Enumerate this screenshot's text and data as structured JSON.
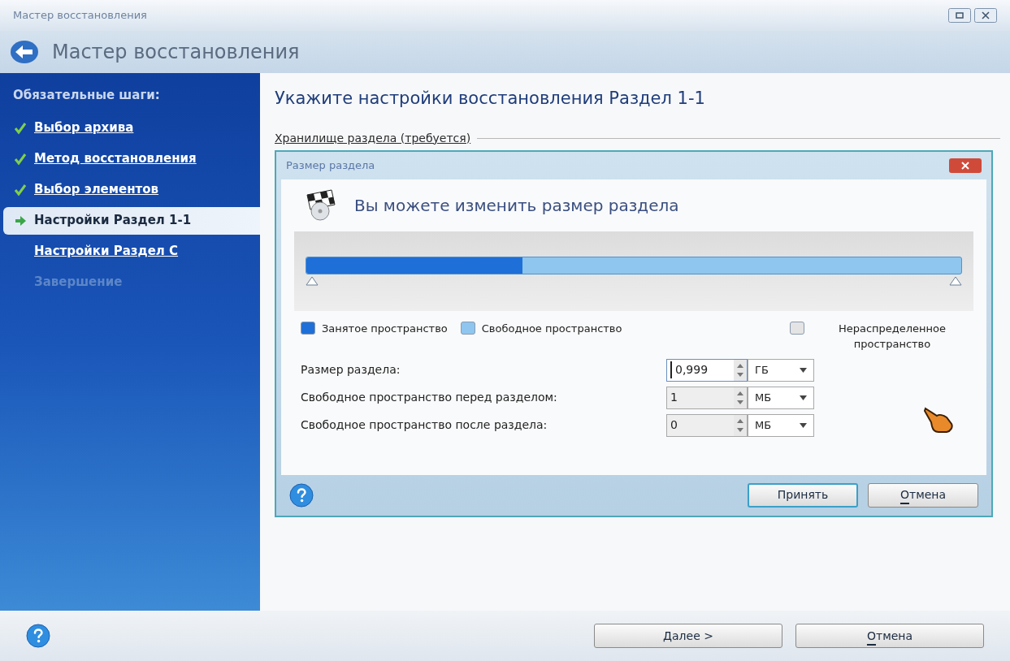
{
  "window": {
    "title": "Мастер восстановления"
  },
  "header": {
    "title": "Мастер восстановления"
  },
  "sidebar": {
    "heading": "Обязательные шаги:",
    "items": [
      {
        "label": "Выбор архива",
        "kind": "done",
        "selected": false
      },
      {
        "label": "Метод восстановления",
        "kind": "done",
        "selected": false
      },
      {
        "label": "Выбор элементов",
        "kind": "done",
        "selected": false
      },
      {
        "label": "Настройки Раздел 1-1",
        "kind": "current",
        "selected": true
      },
      {
        "label": "Настройки Раздел С",
        "kind": "pending",
        "selected": false
      },
      {
        "label": "Завершение",
        "kind": "disabled",
        "selected": false
      }
    ]
  },
  "main": {
    "title": "Укажите настройки восстановления Раздел 1-1",
    "group_label": "Хранилище раздела (требуется)"
  },
  "dialog": {
    "title": "Размер раздела",
    "heading": "Вы можете изменить размер раздела",
    "partition_bar": {
      "level": 0.33
    },
    "legend": [
      {
        "label": "Занятое пространство",
        "color": "#1f6fd8"
      },
      {
        "label": "Свободное пространство",
        "color": "#8ec6ef"
      },
      {
        "label": "Нераспределенное пространство",
        "color": "#e4e4e4"
      }
    ],
    "fields": [
      {
        "label": "Размер раздела:",
        "value": "0,999",
        "unit": "ГБ",
        "focused": true
      },
      {
        "label": "Свободное пространство перед разделом:",
        "value": "1",
        "unit": "МБ",
        "focused": false
      },
      {
        "label": "Свободное пространство после раздела:",
        "value": "0",
        "unit": "МБ",
        "focused": false
      }
    ],
    "buttons": [
      {
        "label": "Принять",
        "default": true,
        "mnemonic": false
      },
      {
        "label": "Отмена",
        "default": false,
        "mnemonic": true
      }
    ]
  },
  "footer": {
    "buttons": [
      {
        "label": "Далее >",
        "default": false,
        "mnemonic": false
      },
      {
        "label": "Отмена",
        "default": false,
        "mnemonic": true
      }
    ]
  }
}
